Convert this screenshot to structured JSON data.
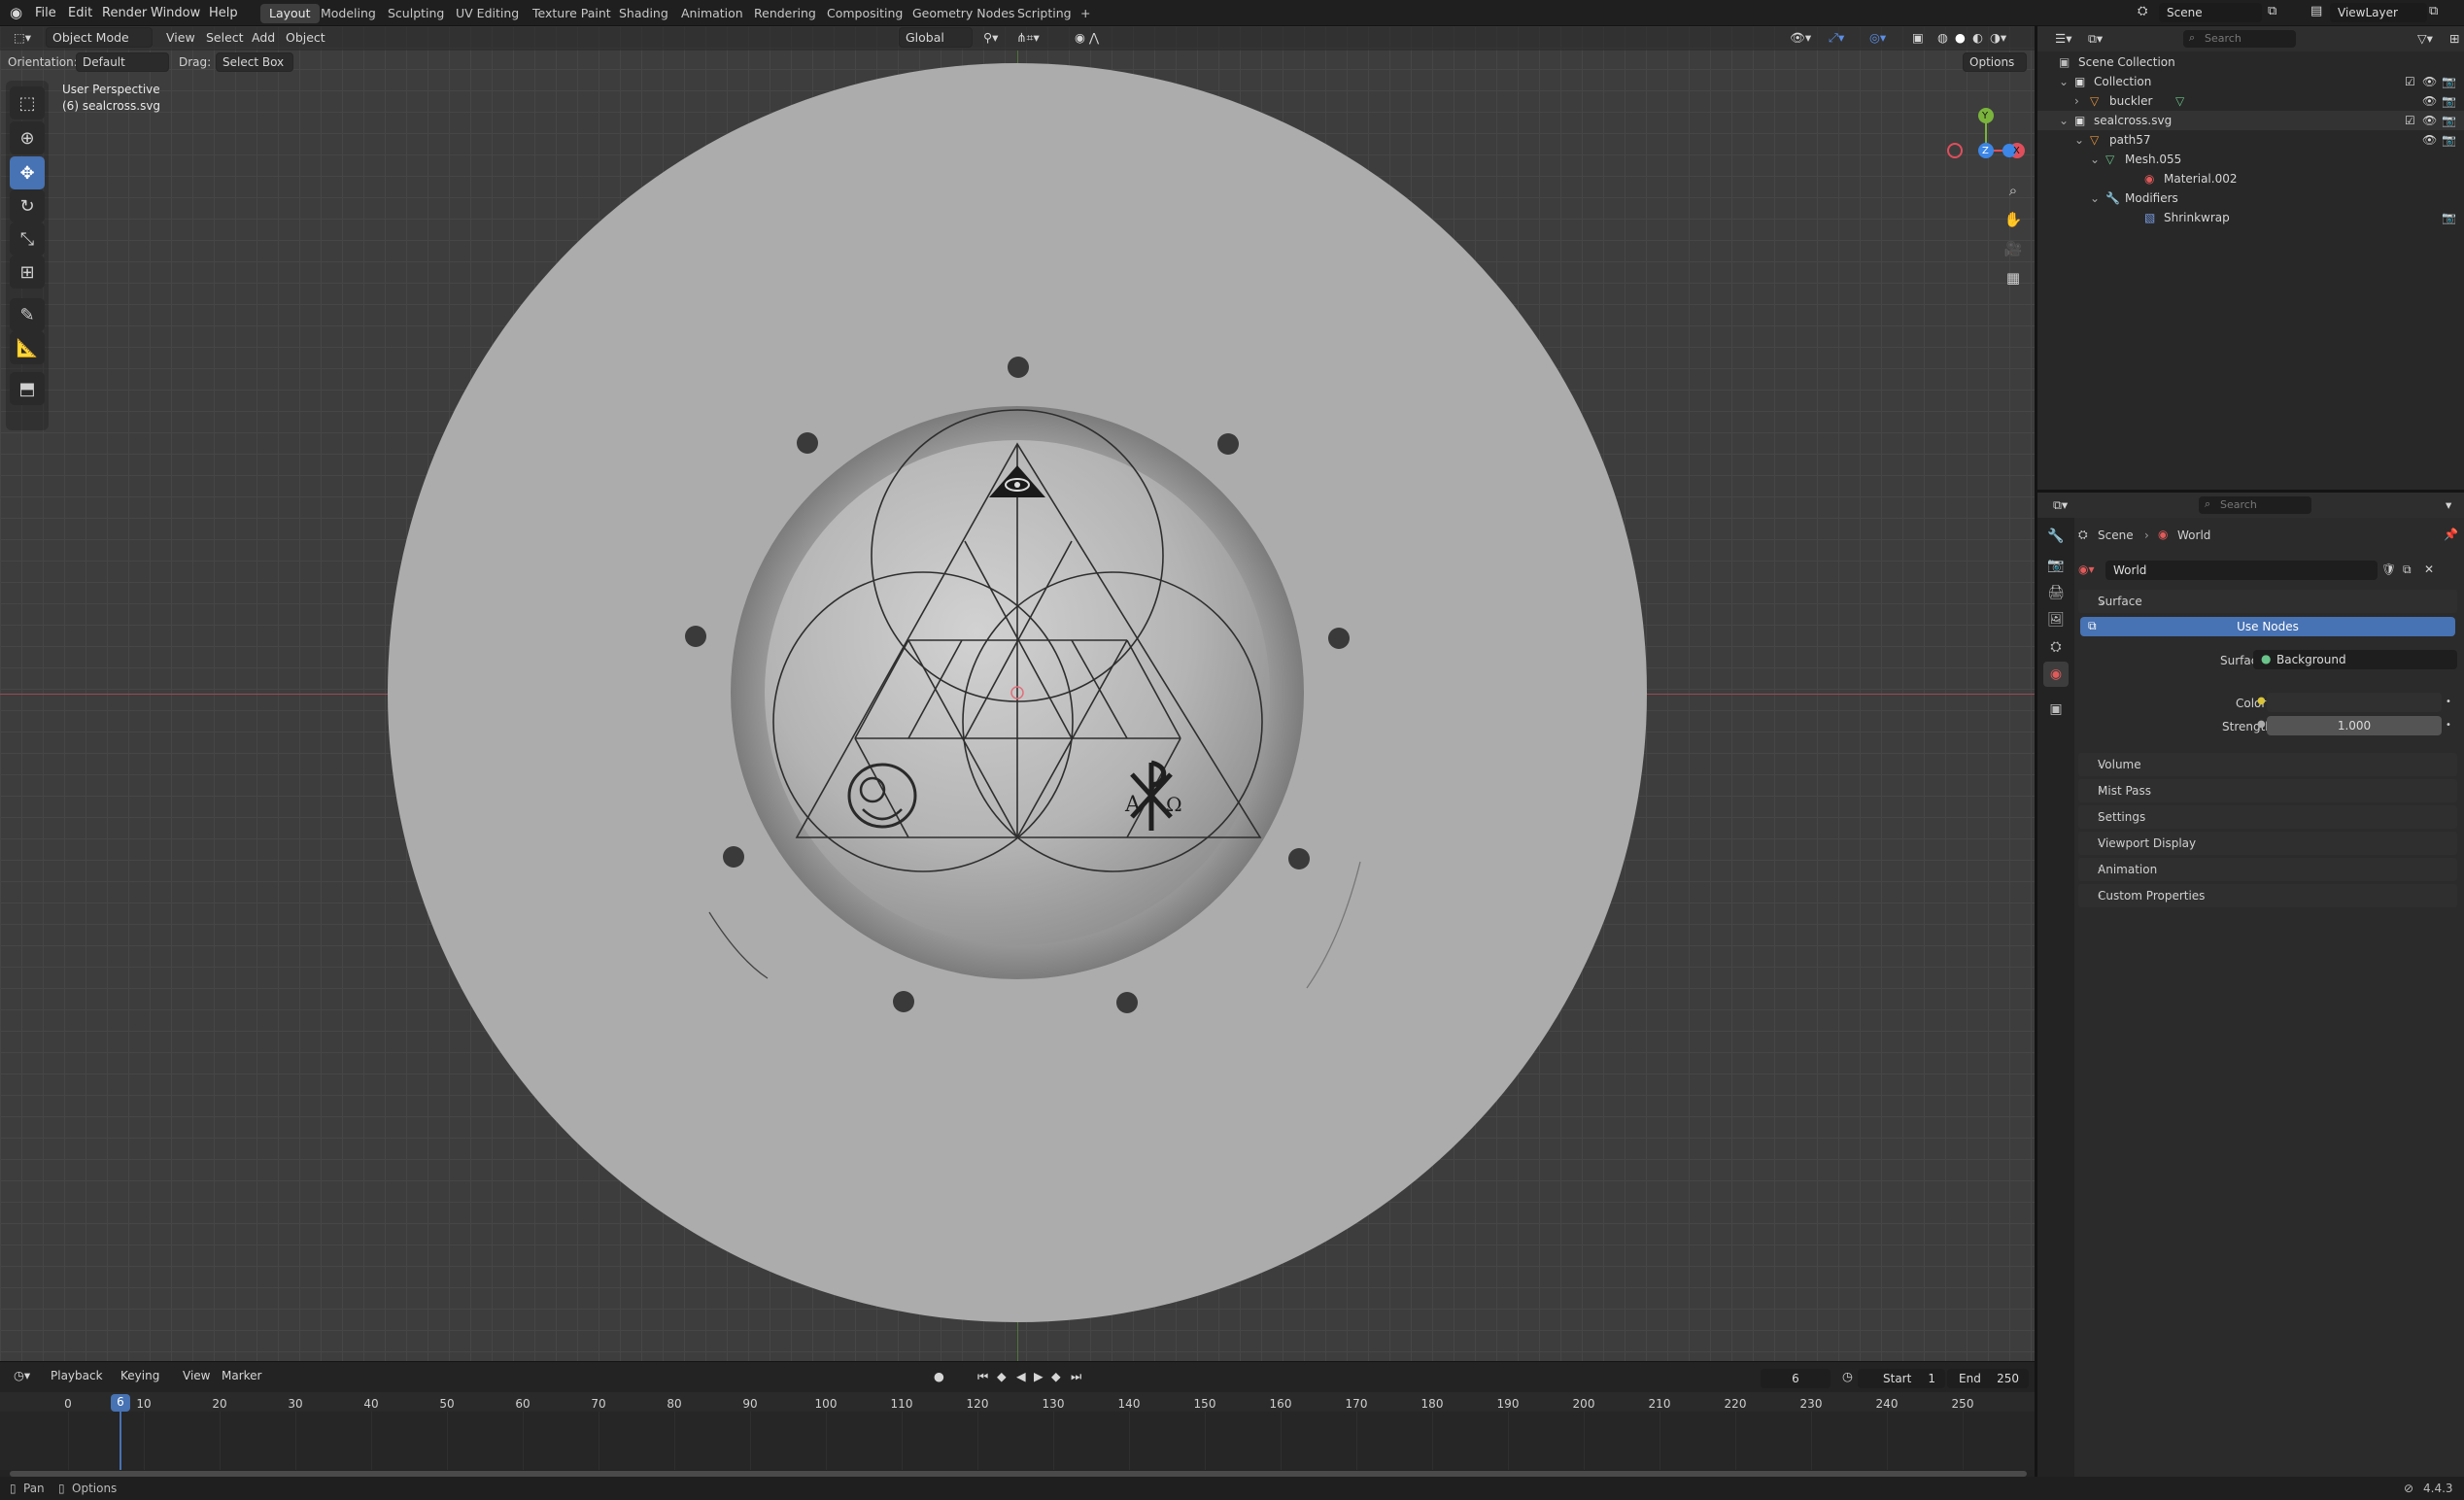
{
  "topbar": {
    "menus": [
      "File",
      "Edit",
      "Render",
      "Window",
      "Help"
    ],
    "workspaces": [
      "Layout",
      "Modeling",
      "Sculpting",
      "UV Editing",
      "Texture Paint",
      "Shading",
      "Animation",
      "Rendering",
      "Compositing",
      "Geometry Nodes",
      "Scripting"
    ],
    "active_workspace": "Layout",
    "add_tab": "+",
    "scene_label": "Scene",
    "viewlayer_label": "ViewLayer"
  },
  "viewport": {
    "mode": "Object Mode",
    "menus": [
      "View",
      "Select",
      "Add",
      "Object"
    ],
    "transform_orientation": "Global",
    "orientation_label": "Orientation:",
    "orientation_value": "Default",
    "drag_label": "Drag:",
    "drag_value": "Select Box",
    "options": "Options",
    "overlay_title": "User Perspective",
    "overlay_subtitle": "(6) sealcross.svg",
    "gizmo": {
      "x": "X",
      "y": "Y",
      "z": "Z"
    }
  },
  "timeline": {
    "menus": [
      "Playback",
      "Keying",
      "View",
      "Marker"
    ],
    "current_frame": "6",
    "start_label": "Start",
    "start_value": "1",
    "end_label": "End",
    "end_value": "250",
    "ticks": [
      "0",
      "10",
      "20",
      "30",
      "40",
      "50",
      "60",
      "70",
      "80",
      "90",
      "100",
      "110",
      "120",
      "130",
      "140",
      "150",
      "160",
      "170",
      "180",
      "190",
      "200",
      "210",
      "220",
      "230",
      "240",
      "250"
    ]
  },
  "status": {
    "pan": "Pan",
    "options": "Options",
    "version": "4.4.3"
  },
  "outliner": {
    "search_placeholder": "Search",
    "rows": [
      {
        "label": "Scene Collection",
        "indent": 0
      },
      {
        "label": "Collection",
        "indent": 1
      },
      {
        "label": "buckler",
        "indent": 2
      },
      {
        "label": "sealcross.svg",
        "indent": 1
      },
      {
        "label": "path57",
        "indent": 2
      },
      {
        "label": "Mesh.055",
        "indent": 3
      },
      {
        "label": "Material.002",
        "indent": 4
      },
      {
        "label": "Modifiers",
        "indent": 3
      },
      {
        "label": "Shrinkwrap",
        "indent": 4
      }
    ]
  },
  "properties": {
    "search_placeholder": "Search",
    "breadcrumb_scene": "Scene",
    "breadcrumb_world": "World",
    "world_name": "World",
    "surface_panel": "Surface",
    "use_nodes": "Use Nodes",
    "surface_label": "Surface",
    "surface_value": "Background",
    "color_label": "Color",
    "strength_label": "Strength",
    "strength_value": "1.000",
    "panels": [
      "Volume",
      "Mist Pass",
      "Settings",
      "Viewport Display",
      "Animation",
      "Custom Properties"
    ]
  }
}
